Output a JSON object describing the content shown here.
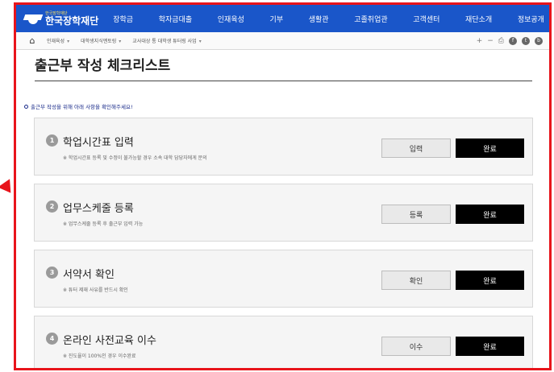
{
  "header": {
    "logo_small": "한국장학재단",
    "logo_name": "한국장학재단",
    "nav": [
      "장학금",
      "학자금대출",
      "인재육성",
      "기부",
      "생활관",
      "고졸취업관",
      "고객센터",
      "재단소개",
      "정보공개"
    ]
  },
  "breadcrumb": {
    "items": [
      "인재육성",
      "대학생지식멘토링",
      "교사대상 통 대학생 튜터링 사업"
    ],
    "tools": [
      "+",
      "−"
    ]
  },
  "page": {
    "title": "출근부 작성 체크리스트",
    "notice": "출근부 작성을 위해 아래 사항을 확인해주세요!"
  },
  "steps": [
    {
      "num": "1",
      "title": "학업시간표 입력",
      "note": "※ 학업시간표 등록 및 수정이 불가능할 경우 소속 대학 담당자에게 문의",
      "action": "입력",
      "done": "완료"
    },
    {
      "num": "2",
      "title": "업무스케줄 등록",
      "note": "※ 업무스케줄 등록 후 출근부 입력 가능",
      "action": "등록",
      "done": "완료"
    },
    {
      "num": "3",
      "title": "서약서 확인",
      "note": "※ 튜터 제재 사유를 반드시 확인",
      "action": "확인",
      "done": "완료"
    },
    {
      "num": "4",
      "title": "온라인 사전교육 이수",
      "note": "※ 진도율이 100%인 경우 이수완료",
      "action": "이수",
      "done": "완료"
    }
  ],
  "colors": {
    "nav_bg": "#1a56c9",
    "highlight": "#e8141b",
    "done_bg": "#000000"
  },
  "icons": [
    "home-icon",
    "print-icon",
    "facebook-icon",
    "twitter-icon",
    "blog-icon"
  ]
}
